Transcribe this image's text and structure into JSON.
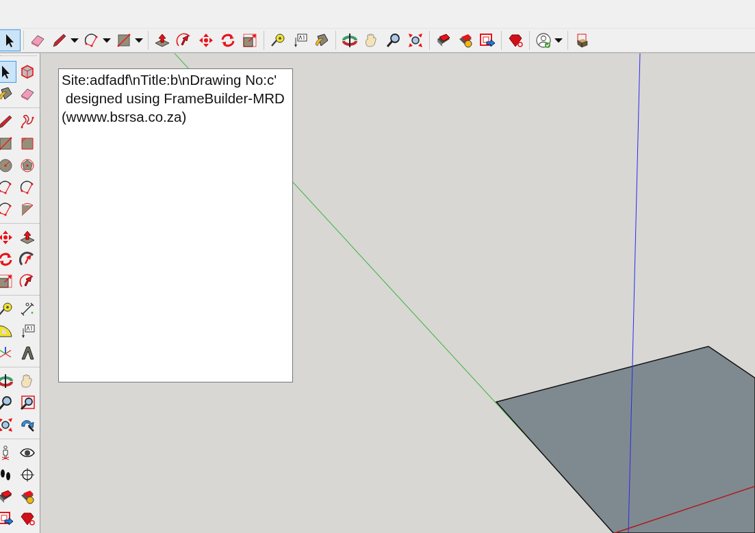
{
  "main_toolbar": {
    "groups": [
      [
        {
          "kind": "select",
          "selected": true,
          "dropdown": false
        }
      ],
      [
        {
          "kind": "eraser",
          "selected": false,
          "dropdown": false
        },
        {
          "kind": "pencil",
          "selected": false,
          "dropdown": true
        },
        {
          "kind": "arc",
          "selected": false,
          "dropdown": true
        },
        {
          "kind": "rectangle",
          "selected": false,
          "dropdown": true
        }
      ],
      [
        {
          "kind": "pushpull",
          "selected": false,
          "dropdown": false
        },
        {
          "kind": "followme",
          "selected": false,
          "dropdown": false
        },
        {
          "kind": "move",
          "selected": false,
          "dropdown": false
        },
        {
          "kind": "rotate",
          "selected": false,
          "dropdown": false
        },
        {
          "kind": "scale",
          "selected": false,
          "dropdown": false
        }
      ],
      [
        {
          "kind": "tape",
          "selected": false,
          "dropdown": false
        },
        {
          "kind": "text",
          "selected": false,
          "dropdown": false
        },
        {
          "kind": "paint",
          "selected": false,
          "dropdown": false
        }
      ],
      [
        {
          "kind": "orbit",
          "selected": false,
          "dropdown": false
        },
        {
          "kind": "pan",
          "selected": false,
          "dropdown": false
        },
        {
          "kind": "zoom",
          "selected": false,
          "dropdown": false
        },
        {
          "kind": "zoomext",
          "selected": false,
          "dropdown": false
        }
      ],
      [
        {
          "kind": "warehouse",
          "selected": false,
          "dropdown": false
        },
        {
          "kind": "extwarehouse",
          "selected": false,
          "dropdown": false
        },
        {
          "kind": "layout",
          "selected": false,
          "dropdown": false
        }
      ],
      [
        {
          "kind": "ruby",
          "selected": false,
          "dropdown": false
        }
      ],
      [
        {
          "kind": "account",
          "selected": false,
          "dropdown": true
        }
      ],
      [
        {
          "kind": "component",
          "selected": false,
          "dropdown": false
        }
      ]
    ]
  },
  "left_toolbar": {
    "groups": [
      [
        {
          "kind": "select",
          "selected": true
        },
        {
          "kind": "makecomponent",
          "selected": false
        },
        {
          "kind": "paint",
          "selected": false
        },
        {
          "kind": "eraser",
          "selected": false
        }
      ],
      [
        {
          "kind": "pencil",
          "selected": false
        },
        {
          "kind": "freehand",
          "selected": false
        },
        {
          "kind": "rectangle",
          "selected": false
        },
        {
          "kind": "rotrect",
          "selected": false
        },
        {
          "kind": "circle",
          "selected": false
        },
        {
          "kind": "polygon",
          "selected": false
        },
        {
          "kind": "arc",
          "selected": false
        },
        {
          "kind": "arc",
          "selected": false
        },
        {
          "kind": "arc",
          "selected": false
        },
        {
          "kind": "pie",
          "selected": false
        }
      ],
      [
        {
          "kind": "move",
          "selected": false
        },
        {
          "kind": "pushpull",
          "selected": false
        },
        {
          "kind": "rotate",
          "selected": false
        },
        {
          "kind": "offset",
          "selected": false
        },
        {
          "kind": "scale",
          "selected": false
        },
        {
          "kind": "followme",
          "selected": false
        }
      ],
      [
        {
          "kind": "tape",
          "selected": false
        },
        {
          "kind": "dimension",
          "selected": false
        },
        {
          "kind": "protractor",
          "selected": false
        },
        {
          "kind": "text",
          "selected": false
        },
        {
          "kind": "axes",
          "selected": false
        },
        {
          "kind": "text3d",
          "selected": false
        }
      ],
      [
        {
          "kind": "orbit",
          "selected": false
        },
        {
          "kind": "pan",
          "selected": false
        },
        {
          "kind": "zoom",
          "selected": false
        },
        {
          "kind": "zoomwindow",
          "selected": false
        },
        {
          "kind": "zoomext",
          "selected": false
        },
        {
          "kind": "previous",
          "selected": false
        }
      ],
      [
        {
          "kind": "walk",
          "selected": false
        },
        {
          "kind": "lookaround",
          "selected": false
        },
        {
          "kind": "footprints",
          "selected": false
        },
        {
          "kind": "position",
          "selected": false
        },
        {
          "kind": "warehouse",
          "selected": false
        },
        {
          "kind": "extwarehouse",
          "selected": false
        },
        {
          "kind": "layout",
          "selected": false
        },
        {
          "kind": "ruby",
          "selected": false
        }
      ]
    ]
  },
  "canvas": {
    "text_note": {
      "lines": [
        "Site:adfadf\\nTitle:b\\nDrawing No:c'",
        " designed using FrameBuilder-MRD",
        "(wwww.bsrsa.co.za)"
      ]
    }
  }
}
